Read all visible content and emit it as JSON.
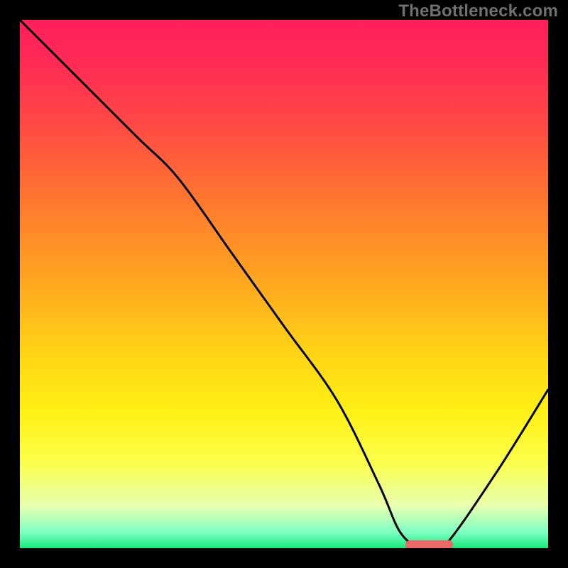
{
  "watermark": "TheBottleneck.com",
  "chart_data": {
    "type": "line",
    "title": "",
    "xlabel": "",
    "ylabel": "",
    "xlim": [
      0,
      100
    ],
    "ylim": [
      0,
      100
    ],
    "grid": false,
    "series": [
      {
        "name": "bottleneck-curve",
        "x": [
          0,
          10,
          22,
          30,
          40,
          50,
          60,
          68,
          72,
          76,
          80,
          90,
          100
        ],
        "y": [
          100,
          90,
          78,
          70,
          56,
          42,
          28,
          12,
          3,
          0,
          0,
          14,
          30
        ]
      }
    ],
    "marker": {
      "name": "optimal-zone",
      "x_start": 73,
      "x_end": 82,
      "y": 0,
      "color": "#e96a68"
    },
    "background_gradient_stops": [
      {
        "pos": 0,
        "color": "#ff1f5c"
      },
      {
        "pos": 50,
        "color": "#ffa81f"
      },
      {
        "pos": 84,
        "color": "#fbff4c"
      },
      {
        "pos": 100,
        "color": "#16e87a"
      }
    ]
  }
}
